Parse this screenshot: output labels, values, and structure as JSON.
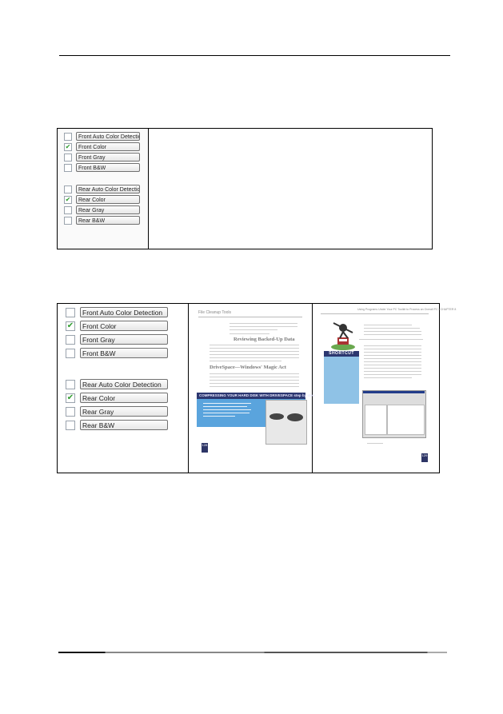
{
  "options_panel_1": {
    "front": [
      {
        "label": "Front Auto Color Detection",
        "checked": false
      },
      {
        "label": "Front Color",
        "checked": true
      },
      {
        "label": "Front Gray",
        "checked": false
      },
      {
        "label": "Front B&W",
        "checked": false
      }
    ],
    "rear": [
      {
        "label": "Rear Auto Color Detection",
        "checked": false
      },
      {
        "label": "Rear Color",
        "checked": true
      },
      {
        "label": "Rear Gray",
        "checked": false
      },
      {
        "label": "Rear B&W",
        "checked": false
      }
    ]
  },
  "options_panel_2": {
    "front": [
      {
        "label": "Front Auto Color Detection",
        "checked": false
      },
      {
        "label": "Front Color",
        "checked": true
      },
      {
        "label": "Front Gray",
        "checked": false
      },
      {
        "label": "Front B&W",
        "checked": false
      }
    ],
    "rear": [
      {
        "label": "Rear Auto Color Detection",
        "checked": false
      },
      {
        "label": "Rear Color",
        "checked": true
      },
      {
        "label": "Rear Gray",
        "checked": false
      },
      {
        "label": "Rear B&W",
        "checked": false
      }
    ]
  },
  "sample_page_front": {
    "header": "File Cleanup Tools",
    "heading_1": "Reviewing Backed-Up Data",
    "heading_2": "DriveSpace—Windows' Magic Act",
    "banner_title": "COMPRESSING YOUR HARD DISK WITH DRIVESPACE step by step",
    "page_number": "128"
  },
  "sample_page_rear": {
    "header": "Using Programs Under Your PC Toolkit to Process an Overall PC • CHAPTER 8",
    "sidebar_title": "SHORTCUT",
    "page_number": "129"
  },
  "check_glyph": "✔",
  "colors": {
    "checkmark": "#2e9c2e",
    "banner_blue": "#5aa4dd",
    "navy": "#2c3770"
  }
}
